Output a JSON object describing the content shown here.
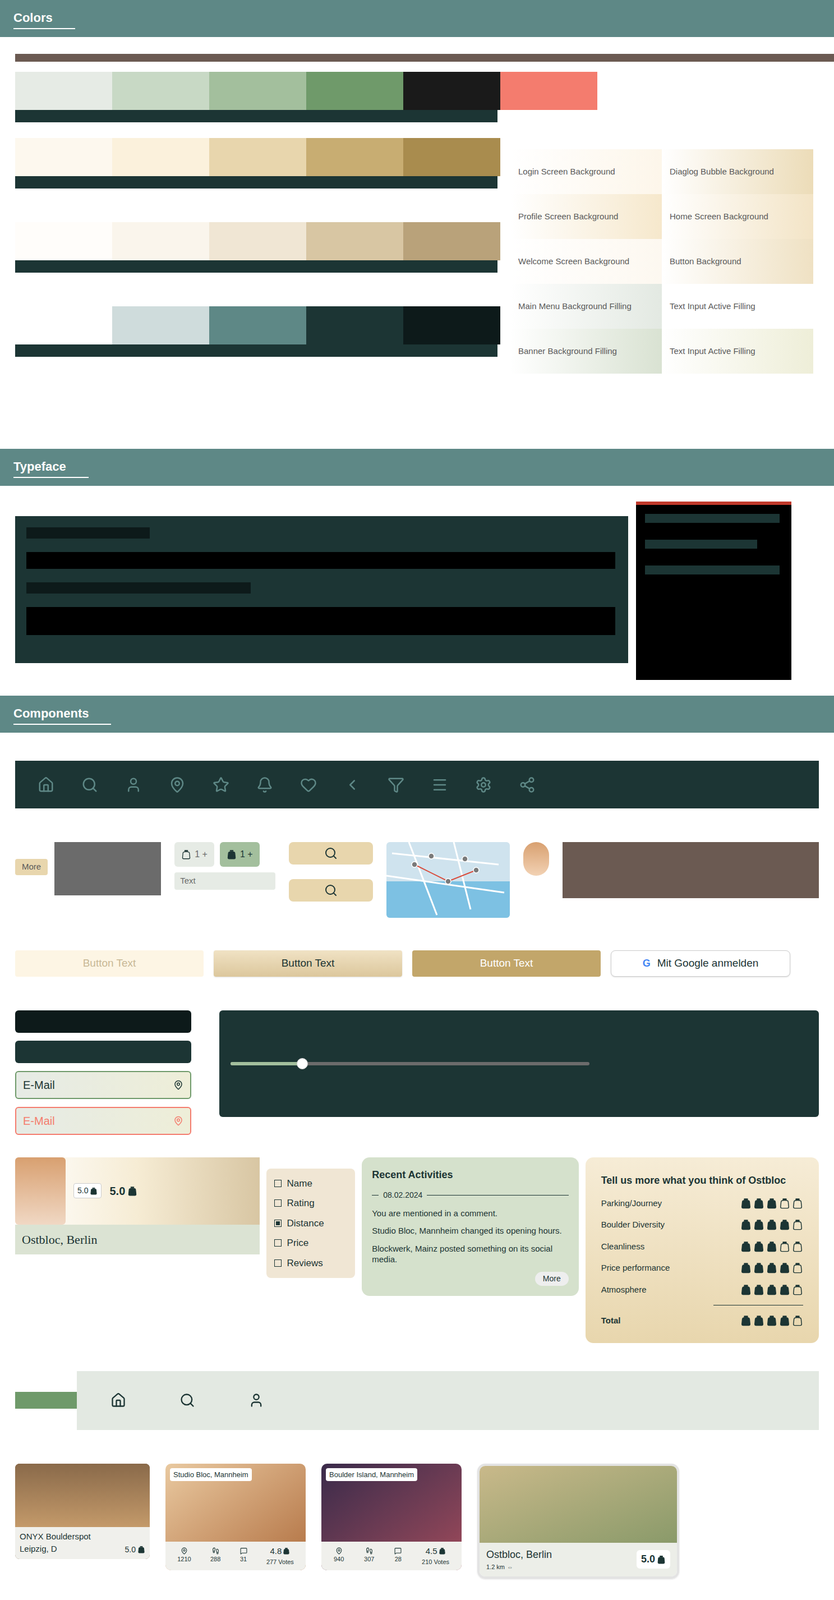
{
  "sections": {
    "colors": "Colors",
    "typeface": "Typeface",
    "components": "Components"
  },
  "palettes": [
    {
      "swatches": [
        {
          "color": "#e6ebe5"
        },
        {
          "color": "#c8d9c5"
        },
        {
          "color": "#a3bf9d"
        },
        {
          "color": "#6f9a6a"
        },
        {
          "color": "#1a1a1a"
        },
        {
          "color": "#f47c6e"
        }
      ]
    },
    {
      "swatches": [
        {
          "color": "#fdf8ee"
        },
        {
          "color": "#fbf1dc"
        },
        {
          "color": "#e8d6ad"
        },
        {
          "color": "#c8ad72"
        },
        {
          "color": "#a98c4e"
        }
      ]
    },
    {
      "swatches": [
        {
          "color": "#fffdfa"
        },
        {
          "color": "#faf5ec"
        },
        {
          "color": "#f0e6d4"
        },
        {
          "color": "#d8c6a3"
        },
        {
          "color": "#b9a27a"
        }
      ]
    },
    {
      "swatches": [
        {
          "color": "#ffffff"
        },
        {
          "color": "#cfdcdc"
        },
        {
          "color": "#5e8886"
        },
        {
          "color": "#1c3534"
        },
        {
          "color": "#0d1a1a"
        }
      ]
    }
  ],
  "backgrounds": [
    {
      "label": "Login Screen Background",
      "color": "#fdf6ea"
    },
    {
      "label": "Diaglog Bubble Background",
      "color": "#ecdcb8"
    },
    {
      "label": "Profile Screen Background",
      "color": "#f6e8cc"
    },
    {
      "label": "Home Screen Background",
      "color": "#f3e4c6"
    },
    {
      "label": "Welcome Screen Background",
      "color": "#fdf8f0"
    },
    {
      "label": "Button Background",
      "color": "#efe1c3"
    },
    {
      "label": "Main Menu Background Filling",
      "color": "#e3e9e2"
    },
    {
      "label": "Text Input Active Filling",
      "color": "#ffffff"
    },
    {
      "label": "Banner Background Filling",
      "color": "#d9e2d2"
    },
    {
      "label": "Text Input Active Filling",
      "color": "#eeeed8"
    }
  ],
  "components": {
    "chip": "More",
    "counters": [
      {
        "label": "1 +",
        "selected": false
      },
      {
        "label": "1 +",
        "selected": true
      }
    ],
    "text_input": "Text",
    "buttons": [
      {
        "label": "Button Text",
        "kind": "disabled"
      },
      {
        "label": "Button Text",
        "kind": "secondary"
      },
      {
        "label": "Button Text",
        "kind": "primary"
      }
    ],
    "google_logo": "G",
    "google_button": "Mit Google anmelden",
    "fields": [
      {
        "label": "E-Mail",
        "error": false
      },
      {
        "label": "E-Mail",
        "error": true
      }
    ],
    "slider": {
      "level": 0.2
    },
    "place": {
      "badge": "5.0",
      "rating": "5.0",
      "name": "Ostbloc, Berlin"
    },
    "filters": [
      {
        "label": "Name",
        "checked": false
      },
      {
        "label": "Rating",
        "checked": false
      },
      {
        "label": "Distance",
        "checked": true
      },
      {
        "label": "Price",
        "checked": false
      },
      {
        "label": "Reviews",
        "checked": false
      }
    ],
    "activities": {
      "title": "Recent Activities",
      "date": "08.02.2024",
      "items": [
        "You are mentioned in a comment.",
        "Studio Bloc, Mannheim changed its opening hours.",
        "Blockwerk, Mainz posted something on its social media."
      ],
      "more": "More"
    },
    "rating": {
      "title": "Tell us more what you think of Ostbloc",
      "rows": [
        {
          "label": "Parking/Journey",
          "stars": 3
        },
        {
          "label": "Boulder Diversity",
          "stars": 4
        },
        {
          "label": "Cleanliness",
          "stars": 3
        },
        {
          "label": "Price performance",
          "stars": 4
        },
        {
          "label": "Atmosphere",
          "stars": 4
        }
      ],
      "total": {
        "label": "Total",
        "stars": 4
      }
    },
    "cards": [
      {
        "kind": "simple",
        "title": "ONYX Boulderspot",
        "subtitle": "Leipzig, D",
        "rating": "5.0"
      },
      {
        "kind": "stats",
        "title": "Studio Bloc, Mannheim",
        "stats": [
          "1210",
          "288",
          "31"
        ],
        "rating": "4.8",
        "votes": "277 Votes"
      },
      {
        "kind": "stats",
        "title": "Boulder Island, Mannheim",
        "stats": [
          "940",
          "307",
          "28"
        ],
        "rating": "4.5",
        "votes": "210 Votes"
      },
      {
        "kind": "large",
        "title": "Ostbloc, Berlin",
        "distance": "1.2 km",
        "distance_icon": "⇔",
        "rating": "5.0"
      }
    ]
  }
}
